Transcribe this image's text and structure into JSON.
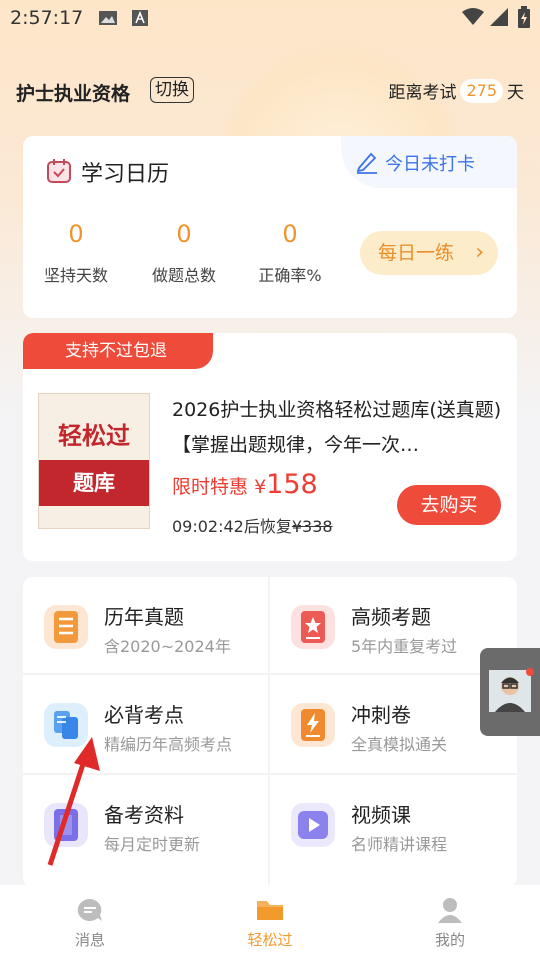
{
  "status_bar": {
    "time": "2:57:17"
  },
  "header": {
    "title": "护士执业资格",
    "switch_label": "切换",
    "exam_prefix": "距离考试",
    "exam_days": "275",
    "exam_suffix": "天"
  },
  "calendar": {
    "title": "学习日历",
    "checkin_label": "今日未打卡",
    "stats": [
      {
        "value": "0",
        "label": "坚持天数"
      },
      {
        "value": "0",
        "label": "做题总数"
      },
      {
        "value": "0",
        "label": "正确率%"
      }
    ],
    "daily_button": "每日一练"
  },
  "promo": {
    "tag": "支持不过包退",
    "cover_line1": "轻松过",
    "cover_line2": "题库",
    "title": "2026护士执业资格轻松过题库(送真题)【掌握出题规律，今年一次…",
    "price_label": "限时特惠",
    "price_currency": "¥",
    "price_value": "158",
    "timer": "09:02:42",
    "timer_suffix": "后恢复",
    "old_price": "¥338",
    "buy_button": "去购买"
  },
  "grid": [
    {
      "title": "历年真题",
      "subtitle": "含2020~2024年",
      "icon": "list-icon"
    },
    {
      "title": "高频考题",
      "subtitle": "5年内重复考过",
      "icon": "star-book-icon"
    },
    {
      "title": "必背考点",
      "subtitle": "精编历年高频考点",
      "icon": "documents-icon"
    },
    {
      "title": "冲刺卷",
      "subtitle": "全真模拟通关",
      "icon": "lightning-icon"
    },
    {
      "title": "备考资料",
      "subtitle": "每月定时更新",
      "icon": "book-icon"
    },
    {
      "title": "视频课",
      "subtitle": "名师精讲课程",
      "icon": "play-icon"
    }
  ],
  "tabbar": [
    {
      "label": "消息",
      "icon": "message-icon"
    },
    {
      "label": "轻松过",
      "icon": "folder-icon"
    },
    {
      "label": "我的",
      "icon": "user-icon"
    }
  ],
  "colors": {
    "accent": "#f0952c",
    "red": "#ef4b3b",
    "blue": "#3b74e8"
  }
}
